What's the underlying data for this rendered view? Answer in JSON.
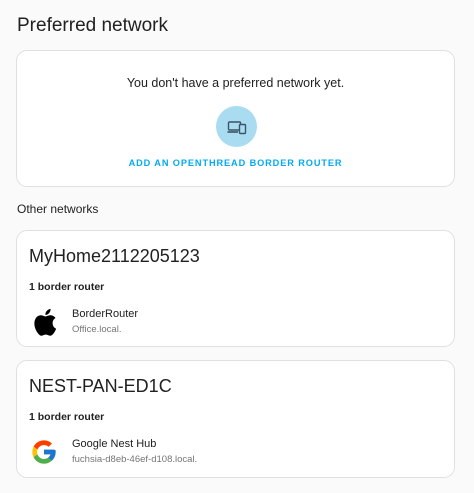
{
  "preferred": {
    "title": "Preferred network",
    "empty_text": "You don't have a preferred network yet.",
    "add_label": "ADD AN OPENTHREAD BORDER ROUTER",
    "add_icon": "router-add-icon"
  },
  "other": {
    "label": "Other networks",
    "networks": [
      {
        "name": "MyHome2112205123",
        "router_count": "1 border router",
        "router": {
          "name": "BorderRouter",
          "host": "Office.local.",
          "icon": "apple-logo-icon"
        }
      },
      {
        "name": "NEST-PAN-ED1C",
        "router_count": "1 border router",
        "router": {
          "name": "Google Nest Hub",
          "host": "fuchsia-d8eb-46ef-d108.local.",
          "icon": "google-logo-icon"
        }
      }
    ]
  },
  "colors": {
    "accent": "#03a9f4",
    "icon_circle": "#a9dcf1",
    "background": "#fafafa",
    "card": "#ffffff"
  }
}
